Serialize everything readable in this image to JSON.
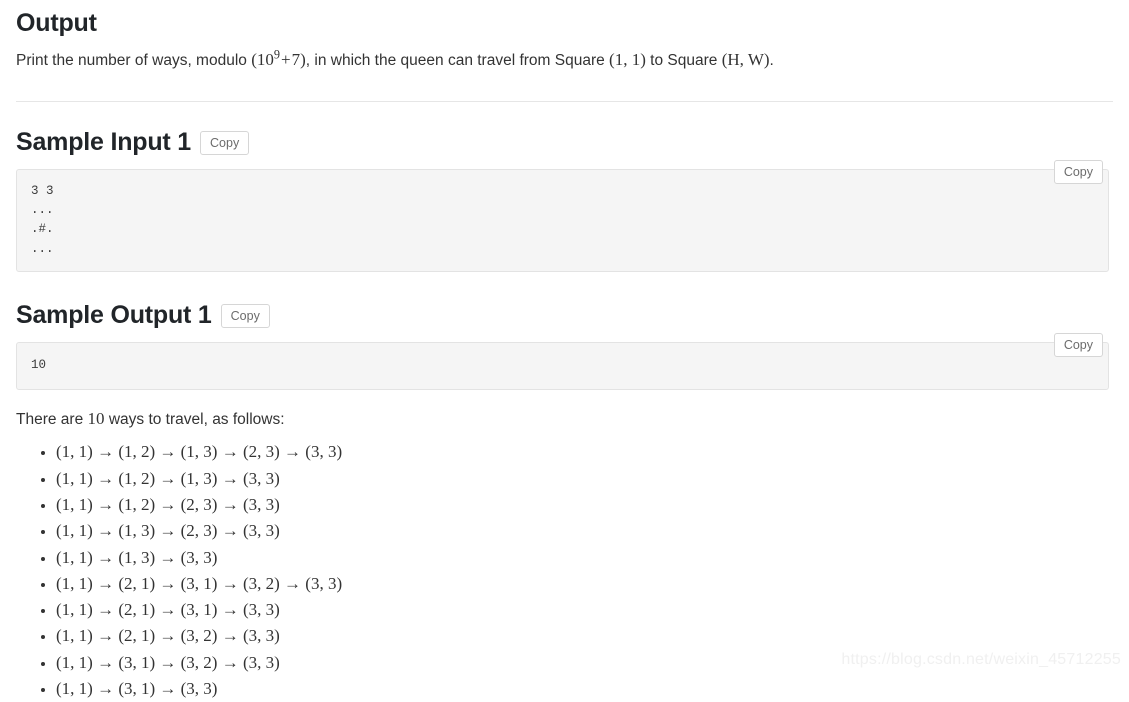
{
  "output_section": {
    "heading": "Output",
    "statement_prefix": "Print the number of ways, modulo ",
    "math_modulo_open": "(",
    "math_base": "10",
    "math_exp": "9",
    "math_plus": "+",
    "math_seven": "7",
    "math_modulo_close": ")",
    "statement_mid": ", in which the queen can travel from Square ",
    "math_start_cell": "(1, 1)",
    "statement_to": " to Square ",
    "math_end_cell": "(H, W)",
    "statement_end": "."
  },
  "sample_input": {
    "heading": "Sample Input 1",
    "copy_label": "Copy",
    "block_copy_label": "Copy",
    "content": "3 3\n...\n.#.\n..."
  },
  "sample_output": {
    "heading": "Sample Output 1",
    "copy_label": "Copy",
    "block_copy_label": "Copy",
    "content": "10",
    "explanation_prefix": "There are ",
    "explanation_count": "10",
    "explanation_suffix": " ways to travel, as follows:",
    "paths": [
      "(1, 1) → (1, 2) → (1, 3) → (2, 3) → (3, 3)",
      "(1, 1) → (1, 2) → (1, 3) → (3, 3)",
      "(1, 1) → (1, 2) → (2, 3) → (3, 3)",
      "(1, 1) → (1, 3) → (2, 3) → (3, 3)",
      "(1, 1) → (1, 3) → (3, 3)",
      "(1, 1) → (2, 1) → (3, 1) → (3, 2) → (3, 3)",
      "(1, 1) → (2, 1) → (3, 1) → (3, 3)",
      "(1, 1) → (2, 1) → (3, 2) → (3, 3)",
      "(1, 1) → (3, 1) → (3, 2) → (3, 3)",
      "(1, 1) → (3, 1) → (3, 3)"
    ]
  },
  "watermark": {
    "text": "https://blog.csdn.net/weixin_45712255"
  }
}
